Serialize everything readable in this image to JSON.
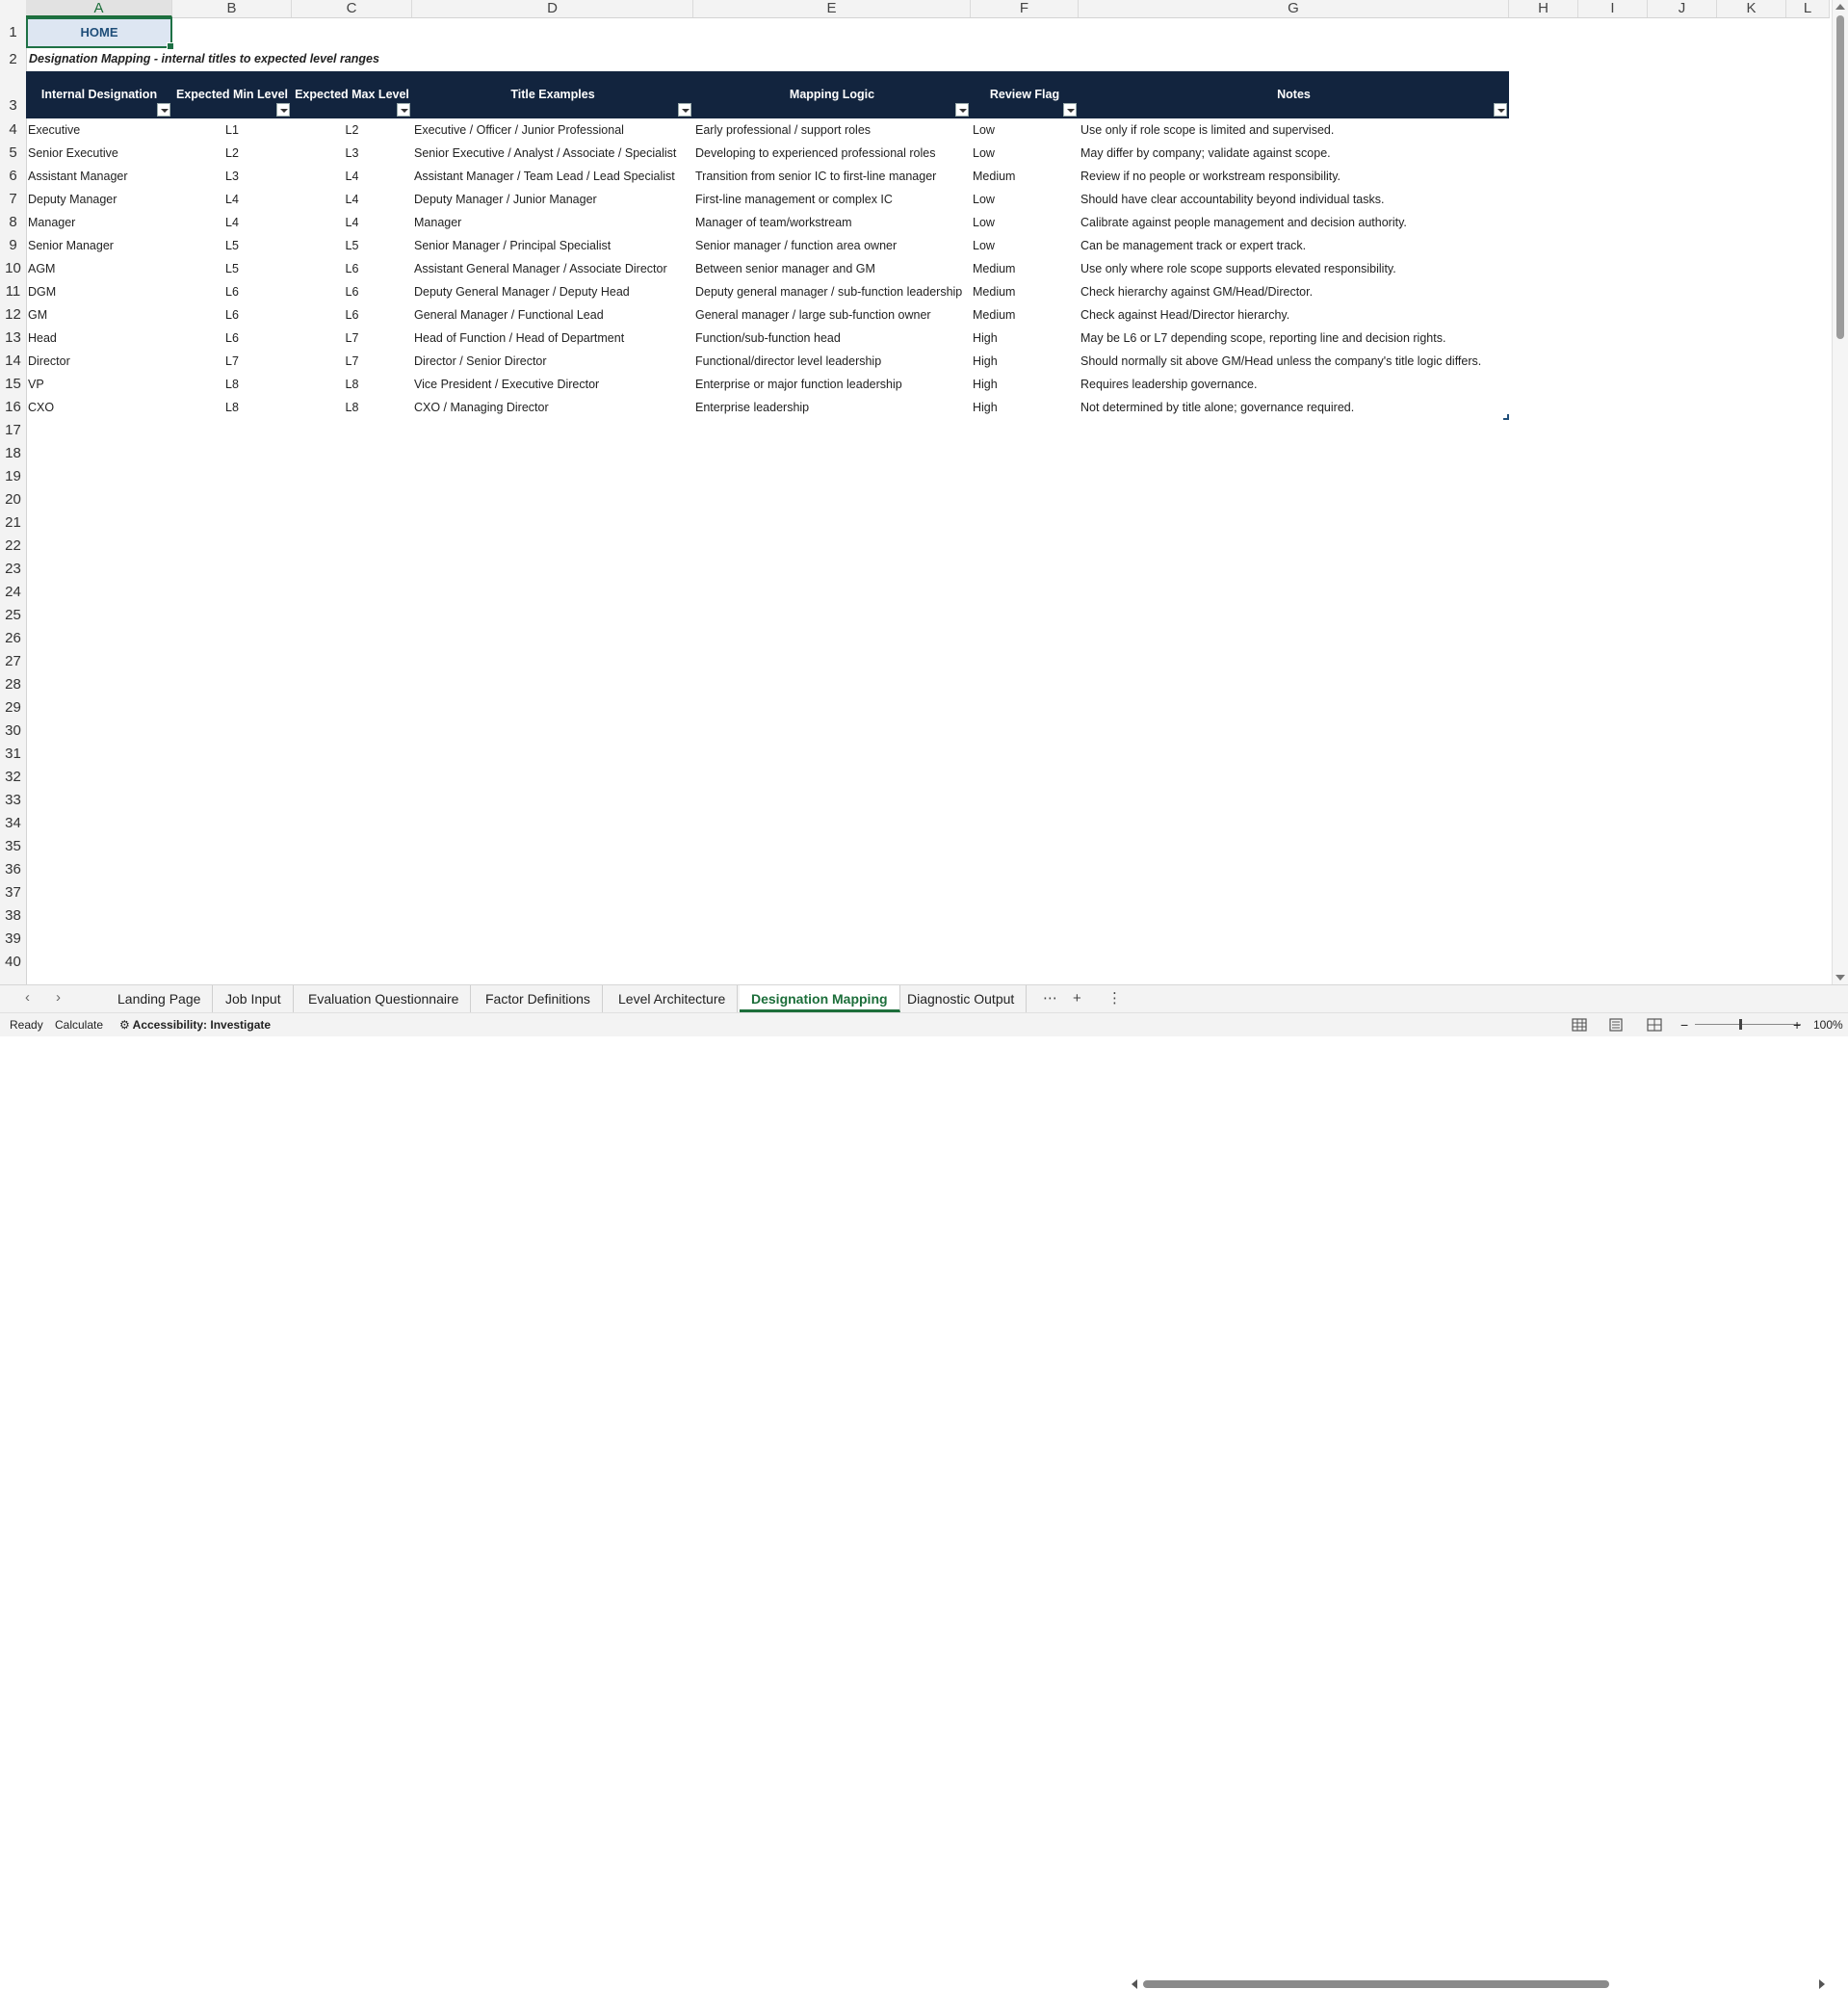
{
  "columns": [
    "A",
    "B",
    "C",
    "D",
    "E",
    "F",
    "G",
    "H",
    "I",
    "J",
    "K",
    "L"
  ],
  "row_numbers": [
    "1",
    "2",
    "3",
    "4",
    "5",
    "6",
    "7",
    "8",
    "9",
    "10",
    "11",
    "12",
    "13",
    "14",
    "15",
    "16",
    "17",
    "18",
    "19",
    "20",
    "21",
    "22",
    "23",
    "24",
    "25",
    "26",
    "27",
    "28",
    "29",
    "30",
    "31",
    "32",
    "33",
    "34",
    "35",
    "36",
    "37",
    "38",
    "39",
    "40"
  ],
  "home_button": "HOME",
  "sheet_title": "Designation Mapping - internal titles to expected level ranges",
  "table": {
    "headers": [
      "Internal Designation",
      "Expected Min Level",
      "Expected Max Level",
      "Title Examples",
      "Mapping Logic",
      "Review Flag",
      "Notes"
    ],
    "rows": [
      [
        "Executive",
        "L1",
        "L2",
        "Executive / Officer / Junior Professional",
        "Early professional / support roles",
        "Low",
        "Use only if role scope is limited and supervised."
      ],
      [
        "Senior Executive",
        "L2",
        "L3",
        "Senior Executive / Analyst / Associate / Specialist",
        "Developing to experienced professional roles",
        "Low",
        "May differ by company; validate against scope."
      ],
      [
        "Assistant Manager",
        "L3",
        "L4",
        "Assistant Manager / Team Lead / Lead Specialist",
        "Transition from senior IC to first-line manager",
        "Medium",
        "Review if no people or workstream responsibility."
      ],
      [
        "Deputy Manager",
        "L4",
        "L4",
        "Deputy Manager / Junior Manager",
        "First-line management or complex IC",
        "Low",
        "Should have clear accountability beyond individual tasks."
      ],
      [
        "Manager",
        "L4",
        "L4",
        "Manager",
        "Manager of team/workstream",
        "Low",
        "Calibrate against people management and decision authority."
      ],
      [
        "Senior Manager",
        "L5",
        "L5",
        "Senior Manager / Principal Specialist",
        "Senior manager / function area owner",
        "Low",
        "Can be management track or expert track."
      ],
      [
        "AGM",
        "L5",
        "L6",
        "Assistant General Manager / Associate Director",
        "Between senior manager and GM",
        "Medium",
        "Use only where role scope supports elevated responsibility."
      ],
      [
        "DGM",
        "L6",
        "L6",
        "Deputy General Manager / Deputy Head",
        "Deputy general manager / sub-function leadership",
        "Medium",
        "Check hierarchy against GM/Head/Director."
      ],
      [
        "GM",
        "L6",
        "L6",
        "General Manager / Functional Lead",
        "General manager / large sub-function owner",
        "Medium",
        "Check against Head/Director hierarchy."
      ],
      [
        "Head",
        "L6",
        "L7",
        "Head of Function / Head of Department",
        "Function/sub-function head",
        "High",
        "May be L6 or L7 depending scope, reporting line and decision rights."
      ],
      [
        "Director",
        "L7",
        "L7",
        "Director / Senior Director",
        "Functional/director level leadership",
        "High",
        "Should normally sit above GM/Head unless the company's title logic differs."
      ],
      [
        "VP",
        "L8",
        "L8",
        "Vice President / Executive Director",
        "Enterprise or major function leadership",
        "High",
        "Requires leadership governance."
      ],
      [
        "CXO",
        "L8",
        "L8",
        "CXO / Managing Director",
        "Enterprise leadership",
        "High",
        "Not determined by title alone; governance required."
      ]
    ]
  },
  "tabs": [
    "Landing Page",
    "Job Input",
    "Evaluation Questionnaire",
    "Factor Definitions",
    "Level Architecture",
    "Designation Mapping",
    "Diagnostic Output"
  ],
  "active_tab": "Designation Mapping",
  "status_bar": {
    "ready": "Ready",
    "calculate": "Calculate",
    "accessibility": "Accessibility: Investigate",
    "zoom": "100%"
  },
  "colors": {
    "header_fill": "#12243e",
    "home_fill": "#dde6f2",
    "accent_green": "#1c6e3a"
  }
}
